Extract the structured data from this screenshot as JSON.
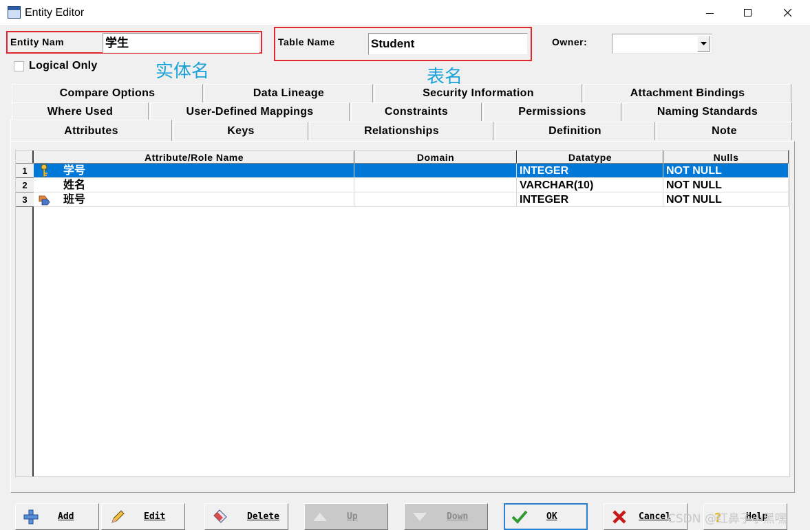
{
  "window": {
    "title": "Entity Editor"
  },
  "header": {
    "entity_name_label": "Entity Nam",
    "entity_name_value": "学生",
    "table_name_label": "Table Name",
    "table_name_value": "Student",
    "owner_label": "Owner:",
    "owner_value": "",
    "logical_only_label": "Logical Only",
    "logical_only_checked": false
  },
  "annotations": {
    "entity": "实体名",
    "table": "表名"
  },
  "tabs": {
    "row1": [
      "Compare Options",
      "Data Lineage",
      "Security Information",
      "Attachment Bindings"
    ],
    "row2": [
      "Where Used",
      "User-Defined Mappings",
      "Constraints",
      "Permissions",
      "Naming Standards"
    ],
    "row3": [
      "Attributes",
      "Keys",
      "Relationships",
      "Definition",
      "Note"
    ],
    "active": "Attributes"
  },
  "grid": {
    "columns": [
      "Attribute/Role Name",
      "Domain",
      "Datatype",
      "Nulls"
    ],
    "rows": [
      {
        "num": "1",
        "icon": "primary-key-icon",
        "name": "学号",
        "domain": "",
        "datatype": "INTEGER",
        "nulls": "NOT NULL",
        "selected": true
      },
      {
        "num": "2",
        "icon": "",
        "name": "姓名",
        "domain": "",
        "datatype": "VARCHAR(10)",
        "nulls": "NOT NULL",
        "selected": false
      },
      {
        "num": "3",
        "icon": "foreign-key-icon",
        "name": "班号",
        "domain": "",
        "datatype": "INTEGER",
        "nulls": "NOT NULL",
        "selected": false
      }
    ]
  },
  "buttons": {
    "add": "Add",
    "edit": "Edit",
    "delete": "Delete",
    "up": "Up",
    "down": "Down",
    "ok": "OK",
    "cancel": "Cancel",
    "help": "Help"
  },
  "watermark": "CSDN @红鼻子小黑嘿",
  "colors": {
    "selection": "#0078d7",
    "highlight_box": "#e0262e",
    "annotation": "#1aa3d9"
  }
}
